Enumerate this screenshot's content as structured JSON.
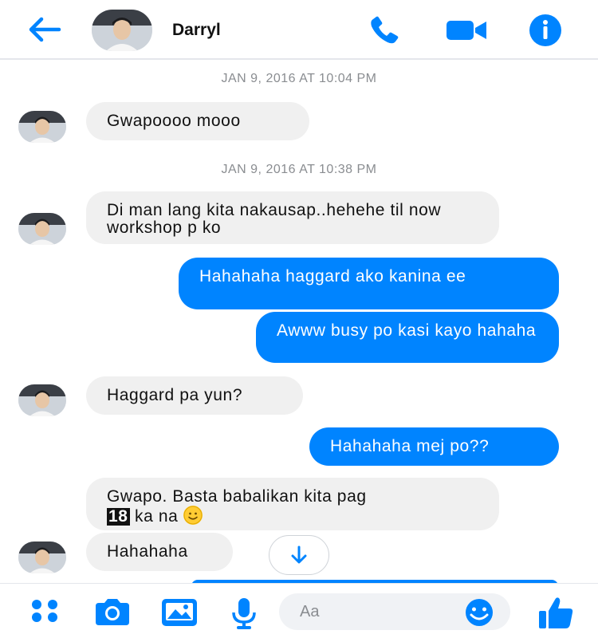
{
  "header": {
    "contact_name": "Darryl",
    "icons": [
      "back-arrow-icon",
      "phone-icon",
      "video-camera-icon",
      "info-icon"
    ]
  },
  "thread": {
    "timestamps": [
      "JAN 9, 2016 AT 10:04 PM",
      "JAN 9, 2016 AT 10:38 PM"
    ],
    "messages": [
      {
        "direction": "incoming",
        "text": "Gwapoooo mooo"
      },
      {
        "direction": "incoming",
        "text": "Di man lang kita nakausap..hehehe til now workshop p ko"
      },
      {
        "direction": "outgoing",
        "text": "Hahahaha haggard ako kanina ee"
      },
      {
        "direction": "outgoing",
        "text": "Awww busy po kasi kayo hahaha"
      },
      {
        "direction": "incoming",
        "text": "Haggard pa yun?"
      },
      {
        "direction": "outgoing",
        "text": "Hahahaha mej po??"
      },
      {
        "direction": "incoming",
        "text_before": "Gwapo. Basta babalikan kita pag",
        "badge": "18",
        "text_after": "ka na",
        "emoji": "slightly-smiling-face"
      },
      {
        "direction": "incoming",
        "text": "Hahahaha"
      }
    ]
  },
  "composer": {
    "placeholder": "Aa",
    "icons": [
      "apps-icon",
      "camera-icon",
      "gallery-icon",
      "microphone-icon",
      "emoji-icon",
      "thumbs-up-icon"
    ]
  },
  "colors": {
    "accent": "#0084ff",
    "incoming_bubble": "#f0f0f0",
    "timestamp_text": "#8a8d91"
  }
}
